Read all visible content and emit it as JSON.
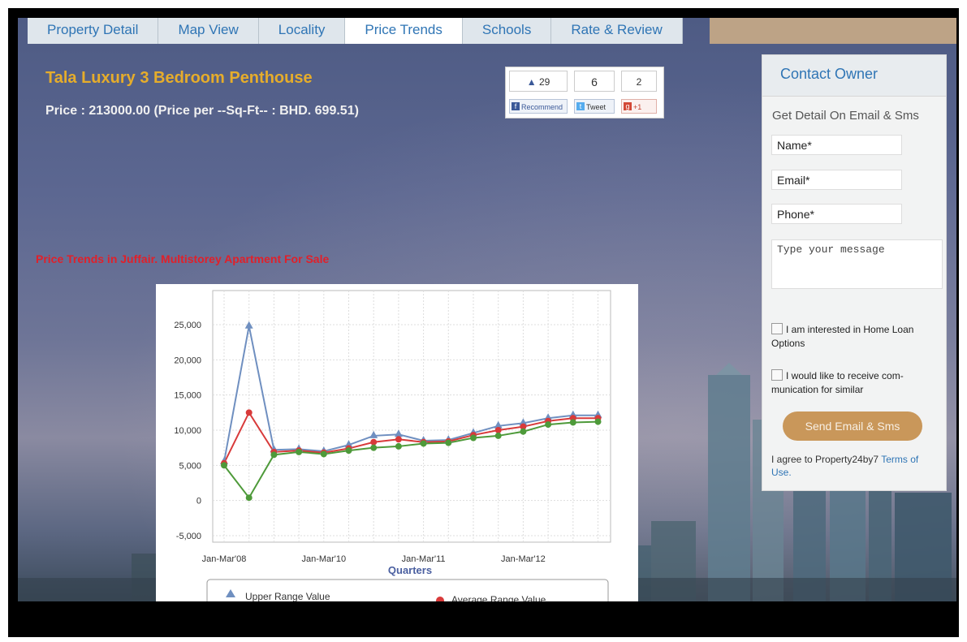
{
  "tabs": [
    "Property Detail",
    "Map View",
    "Locality",
    "Price Trends",
    "Schools",
    "Rate & Review"
  ],
  "active_tab": "Price Trends",
  "listing": {
    "title": "Tala Luxury 3 Bedroom Penthouse",
    "price": "Price : 213000.00 (Price per --Sq-Ft-- : BHD. 699.51)"
  },
  "social": {
    "like_count": "29",
    "tweet_count": "6",
    "plus_count": "2",
    "recommend_label": "Recommend",
    "tweet_label": "Tweet",
    "plus_label": "+1"
  },
  "trend_heading": "Price Trends in Juffair. Multistorey Apartment For Sale",
  "contact": {
    "header": "Contact Owner",
    "subtitle": "Get Detail On Email & Sms",
    "name_placeholder": "Name*",
    "email_placeholder": "Email*",
    "phone_placeholder": "Phone*",
    "message_placeholder": "Type your message",
    "loan_label": "I am interested in Home Loan Options",
    "comm_label": "I would like to receive com-munication for similar",
    "send_label": "Send Email & Sms",
    "agree_text": "I agree to Property24by7",
    "terms_link": "Terms of Use."
  },
  "colors": {
    "title": "#e6ad2b",
    "heading_red": "#e0202a",
    "tab_text": "#2f75b5",
    "upper": "#6f8fc0",
    "average": "#d83a3a",
    "lower": "#4e9a3a"
  },
  "chart_data": {
    "type": "line",
    "xlabel": "Quarters",
    "ylabel": "",
    "ylim": [
      -5000,
      25000
    ],
    "yticks": [
      "25,000",
      "20,000",
      "15,000",
      "10,000",
      "5,000",
      "0",
      "-5,000"
    ],
    "xtick_labels": [
      "Jan-Mar'08",
      "Jan-Mar'10",
      "Jan-Mar'11",
      "Jan-Mar'12"
    ],
    "grid": true,
    "legend": "bottom",
    "series": [
      {
        "name": "Upper Range Value",
        "values": [
          5500,
          24800,
          7200,
          7300,
          7000,
          7900,
          9200,
          9400,
          8500,
          8600,
          9600,
          10600,
          11000,
          11700,
          12100,
          12100
        ]
      },
      {
        "name": "Average Range Value",
        "values": [
          5300,
          12500,
          6900,
          7100,
          6800,
          7400,
          8300,
          8700,
          8300,
          8400,
          9300,
          10000,
          10500,
          11300,
          11700,
          11700
        ]
      },
      {
        "name": "",
        "values": [
          5000,
          400,
          6500,
          6900,
          6600,
          7100,
          7500,
          7700,
          8100,
          8200,
          8900,
          9200,
          9800,
          10800,
          11100,
          11200
        ]
      }
    ]
  }
}
